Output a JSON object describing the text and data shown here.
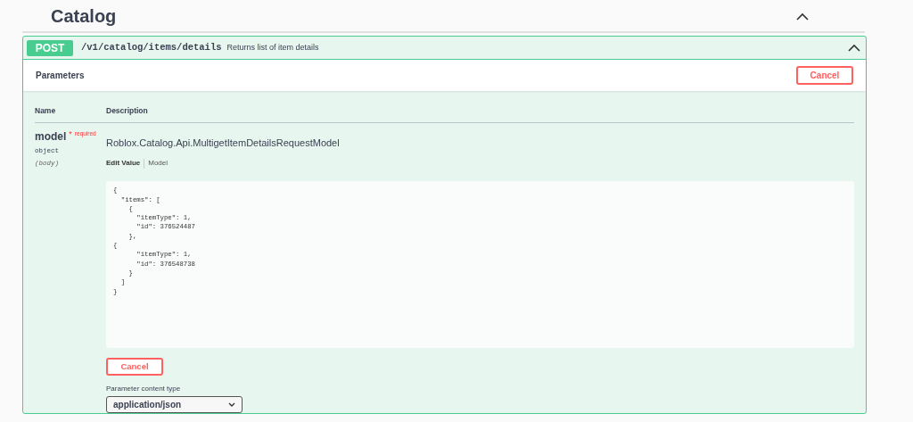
{
  "section": {
    "title": "Catalog",
    "expanded": true
  },
  "operation": {
    "method": "POST",
    "path": "/v1/catalog/items/details",
    "summary": "Returns list of item details",
    "expanded": true
  },
  "parameters": {
    "title": "Parameters",
    "cancel_button": "Cancel",
    "columns": [
      "Name",
      "Description"
    ],
    "rows": [
      {
        "name": "model",
        "required_mark": "*",
        "required_label": "required",
        "type": "object",
        "location": "(body)",
        "model_name": "Roblox.Catalog.Api.MultigetItemDetailsRequestModel",
        "tabs": [
          {
            "label": "Edit Value",
            "selected": true
          },
          {
            "label": "Model",
            "selected": false
          }
        ],
        "body_value": "{\n  \"items\": [\n    {\n      \"itemType\": 1,\n      \"id\": 376524487\n    },\n{\n      \"itemType\": 1,\n      \"id\": 376548738\n    }\n  ]\n}",
        "cancel_button": "Cancel",
        "content_type_label": "Parameter content type",
        "content_type": "application/json"
      }
    ]
  }
}
